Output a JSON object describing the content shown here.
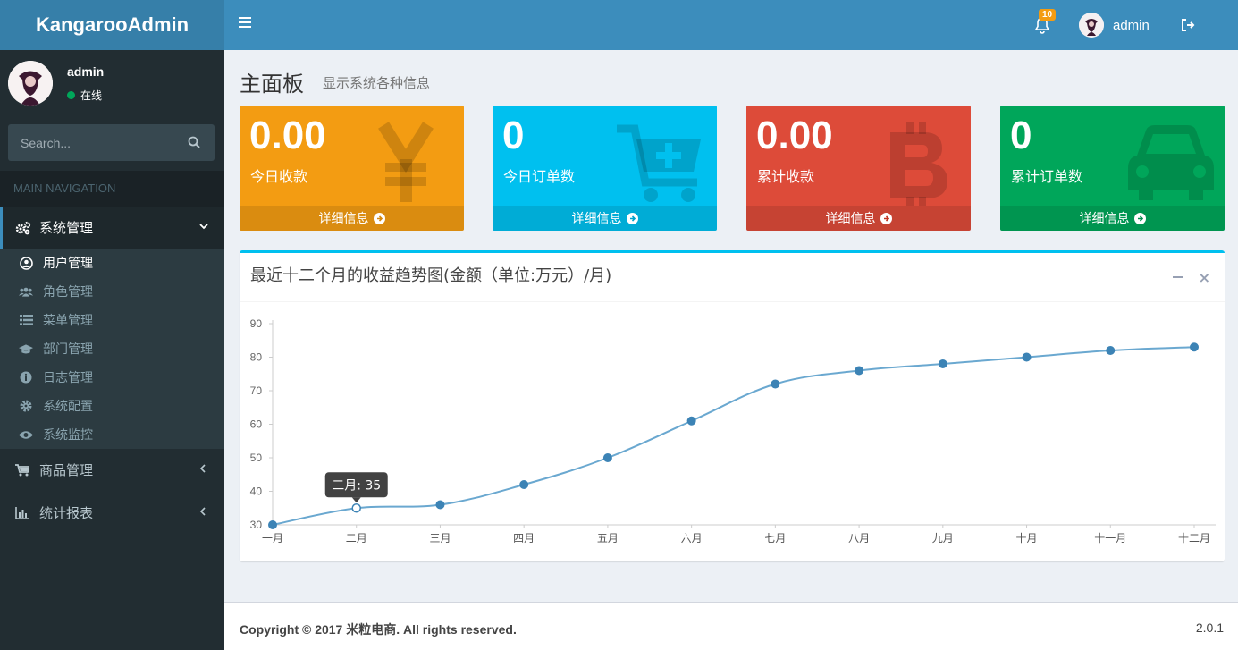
{
  "app": {
    "logo": "KangarooAdmin",
    "notification_count": "10",
    "user_name": "admin"
  },
  "sidebar": {
    "user_name": "admin",
    "status": "在线",
    "search_placeholder": "Search...",
    "nav_header": "MAIN NAVIGATION",
    "active_menu": {
      "label": "系统管理",
      "icon": "cogs-icon"
    },
    "submenu": [
      {
        "label": "用户管理",
        "icon": "user-circle-icon",
        "active": true
      },
      {
        "label": "角色管理",
        "icon": "users-icon"
      },
      {
        "label": "菜单管理",
        "icon": "list-icon"
      },
      {
        "label": "部门管理",
        "icon": "graduation-cap-icon"
      },
      {
        "label": "日志管理",
        "icon": "info-circle-icon"
      },
      {
        "label": "系统配置",
        "icon": "cog-icon"
      },
      {
        "label": "系统监控",
        "icon": "eye-icon"
      }
    ],
    "menus": [
      {
        "label": "商品管理",
        "icon": "cart-icon"
      },
      {
        "label": "统计报表",
        "icon": "bar-chart-icon"
      }
    ]
  },
  "header": {
    "title": "主面板",
    "subtitle": "显示系统各种信息"
  },
  "stats": [
    {
      "value": "0.00",
      "label": "今日收款",
      "footer": "详细信息",
      "color": "#f39c12",
      "icon": "yen-icon"
    },
    {
      "value": "0",
      "label": "今日订单数",
      "footer": "详细信息",
      "color": "#00c0ef",
      "icon": "cart-plus-icon"
    },
    {
      "value": "0.00",
      "label": "累计收款",
      "footer": "详细信息",
      "color": "#dd4b39",
      "icon": "bitcoin-icon"
    },
    {
      "value": "0",
      "label": "累计订单数",
      "footer": "详细信息",
      "color": "#00a65a",
      "icon": "car-icon"
    }
  ],
  "chart_panel": {
    "title": "最近十二个月的收益趋势图(金额（单位:万元）/月)",
    "tooltip": "二月: 35"
  },
  "chart_data": {
    "type": "line",
    "categories": [
      "一月",
      "二月",
      "三月",
      "四月",
      "五月",
      "六月",
      "七月",
      "八月",
      "九月",
      "十月",
      "十一月",
      "十二月"
    ],
    "values": [
      30,
      35,
      36,
      42,
      50,
      61,
      72,
      76,
      78,
      80,
      82,
      83
    ],
    "ylim": [
      30,
      90
    ],
    "yticks": [
      30,
      40,
      50,
      60,
      70,
      80,
      90
    ],
    "smooth": true,
    "line_color": "#6aa8d0",
    "point_color": "#3c83b5",
    "highlighted_index": 1
  },
  "footer": {
    "copyright": "Copyright © 2017 米粒电商. All rights reserved.",
    "version": "2.0.1"
  }
}
